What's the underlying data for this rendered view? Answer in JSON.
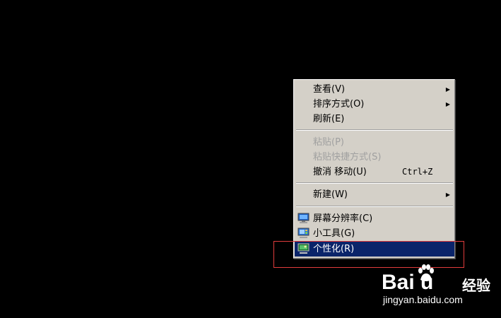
{
  "menu": {
    "items": [
      {
        "label": "查看(V)",
        "submenu": true
      },
      {
        "label": "排序方式(O)",
        "submenu": true
      },
      {
        "label": "刷新(E)"
      },
      {
        "label": "粘贴(P)",
        "disabled": true
      },
      {
        "label": "粘贴快捷方式(S)",
        "disabled": true
      },
      {
        "label": "撤消 移动(U)",
        "shortcut": "Ctrl+Z"
      },
      {
        "label": "新建(W)",
        "submenu": true
      },
      {
        "label": "屏幕分辨率(C)",
        "icon": "monitor-resolution-icon"
      },
      {
        "label": "小工具(G)",
        "icon": "gadgets-icon"
      },
      {
        "label": "个性化(R)",
        "icon": "personalize-icon",
        "selected": true
      }
    ],
    "submenu_arrow": "▶"
  },
  "watermark": {
    "logo": "Bai  u",
    "brand": "经验",
    "url": "jingyan.baidu.com"
  },
  "colors": {
    "background": "#000000",
    "menu_bg": "#d4d0c8",
    "selected_bg": "#0a246a",
    "highlight_border": "#e03c3c"
  }
}
